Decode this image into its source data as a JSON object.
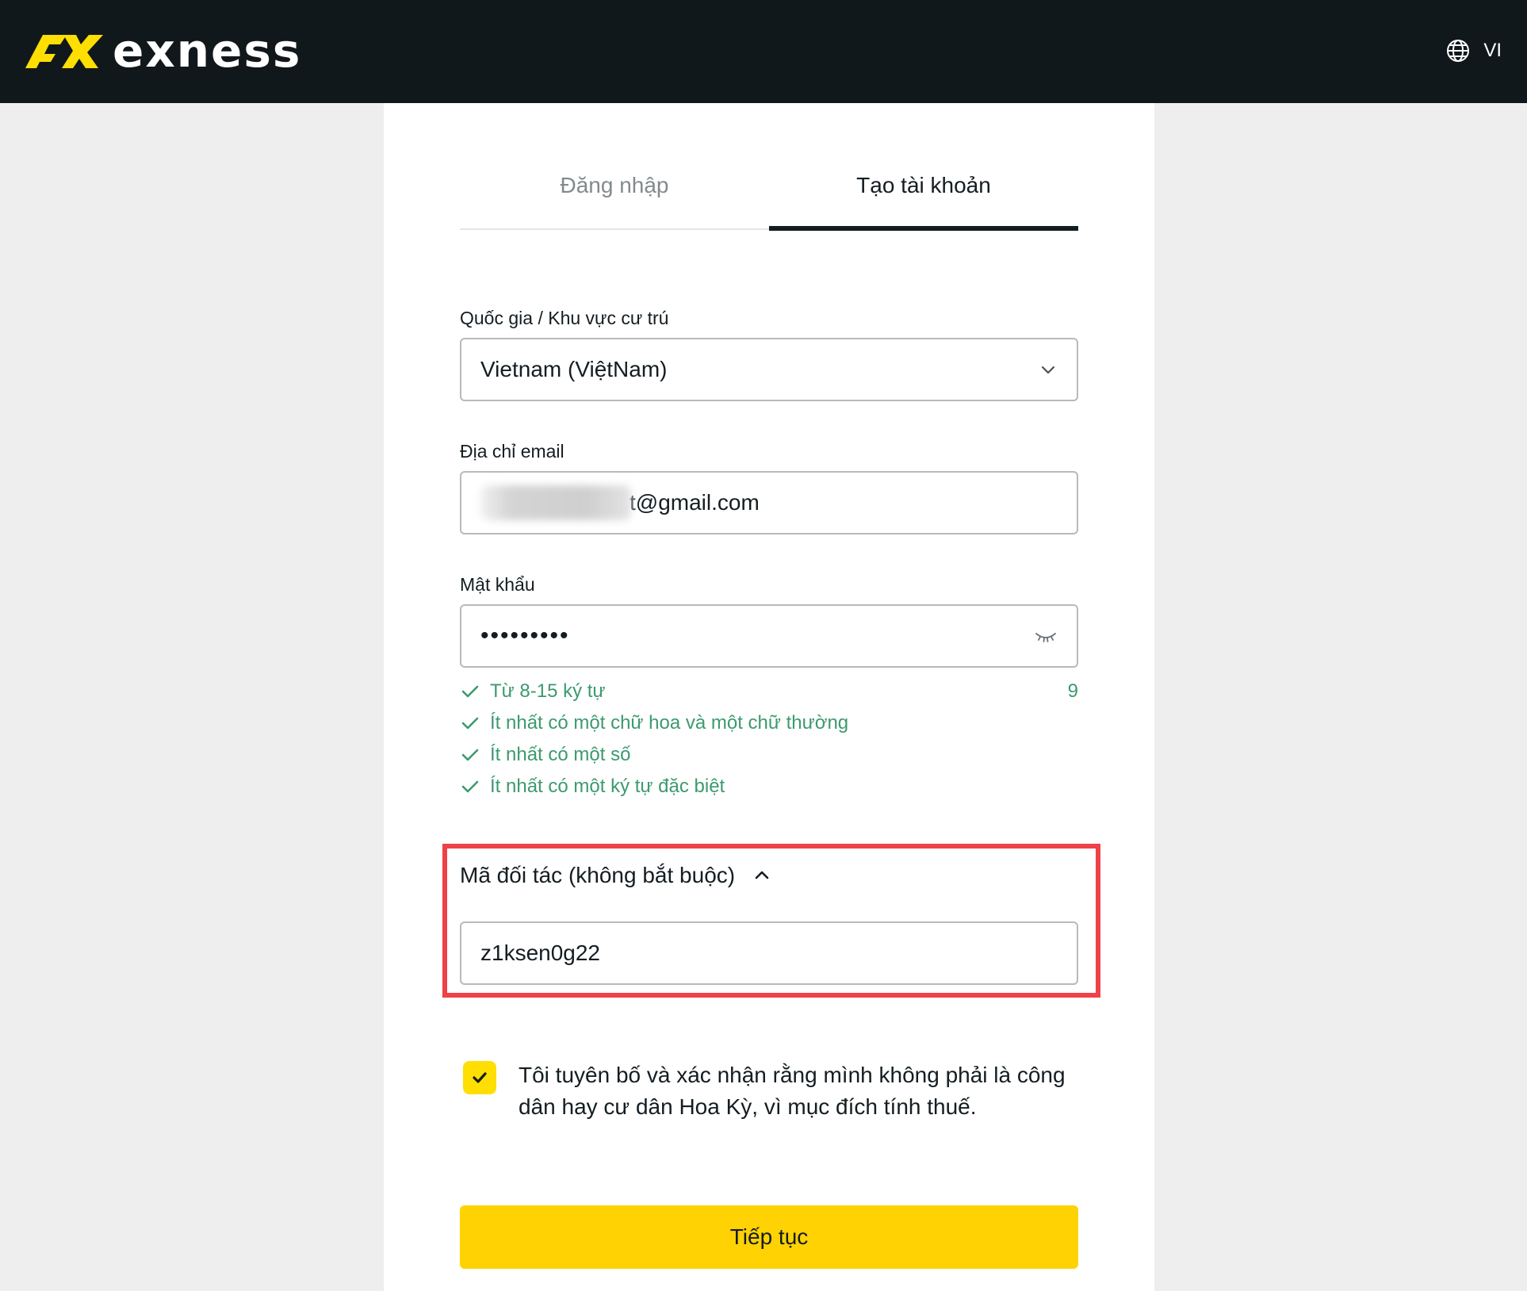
{
  "header": {
    "brand": "exness",
    "language": "VI"
  },
  "tabs": [
    {
      "label": "Đăng nhập",
      "active": false
    },
    {
      "label": "Tạo tài khoản",
      "active": true
    }
  ],
  "form": {
    "country": {
      "label": "Quốc gia / Khu vực cư trú",
      "value": "Vietnam (ViệtNam)"
    },
    "email": {
      "label": "Địa chỉ email",
      "value_visible_part": "t@gmail.com"
    },
    "password": {
      "label": "Mật khẩu",
      "masked_value": "•••••••••",
      "char_count": "9"
    },
    "password_rules": [
      "Từ 8-15 ký tự",
      "Ít nhất có một chữ hoa và một chữ thường",
      "Ít nhất có một số",
      "Ít nhất có một ký tự đặc biệt"
    ],
    "partner_code": {
      "label": "Mã đối tác (không bắt buộc)",
      "value": "z1ksen0g22",
      "expanded": true
    },
    "consent": {
      "checked": true,
      "text": "Tôi tuyên bố và xác nhận rằng mình không phải là công dân hay cư dân Hoa Kỳ, vì mục đích tính thuế."
    },
    "submit_label": "Tiếp tục"
  },
  "colors": {
    "topbar": "#11181c",
    "brand_yellow": "#ffde02",
    "button_yellow": "#ffd204",
    "success_green": "#3c9a6e",
    "highlight_red": "#ef4148"
  },
  "icons": {
    "language": "globe-icon",
    "country_dropdown": "chevron-down-icon",
    "password_toggle": "eye-closed-icon",
    "rule_ok": "check-icon",
    "partner_toggle": "chevron-up-icon",
    "consent_checkbox": "checkmark-icon"
  }
}
